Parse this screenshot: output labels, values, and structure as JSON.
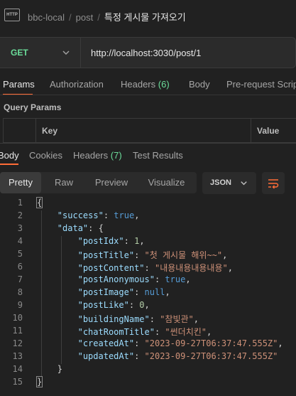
{
  "header": {
    "app_icon": "http-file-icon",
    "app_icon_text": "HTTP",
    "breadcrumb": [
      "bbc-local",
      "post"
    ],
    "separator": "/",
    "request_name": "특정 게시물 가져오기"
  },
  "request": {
    "method": "GET",
    "method_color": "#6bdd9a",
    "url": "http://localhost:3030/post/1"
  },
  "request_tabs": [
    {
      "label": "Params",
      "count": null,
      "active": true
    },
    {
      "label": "Authorization",
      "count": null,
      "active": false
    },
    {
      "label": "Headers",
      "count": "(6)",
      "active": false
    },
    {
      "label": "Body",
      "count": null,
      "active": false
    },
    {
      "label": "Pre-request Scrip",
      "count": null,
      "active": false
    }
  ],
  "query_params": {
    "title": "Query Params",
    "columns": [
      "Key",
      "Value"
    ]
  },
  "response_tabs": [
    {
      "label": "Body",
      "count": null,
      "active": true
    },
    {
      "label": "Cookies",
      "count": null,
      "active": false
    },
    {
      "label": "Headers",
      "count": "(7)",
      "active": false
    },
    {
      "label": "Test Results",
      "count": null,
      "active": false
    }
  ],
  "view_modes": [
    "Pretty",
    "Raw",
    "Preview",
    "Visualize"
  ],
  "active_view_mode": "Pretty",
  "format": "JSON",
  "wrap_icon": "wrap-lines-icon",
  "accent_color": "#ff6c37",
  "response_lines": [
    {
      "n": "1",
      "tokens": [
        [
          "p",
          "{"
        ]
      ]
    },
    {
      "n": "2",
      "tokens": [
        [
          "k",
          "\"success\""
        ],
        [
          "p",
          ": "
        ],
        [
          "b",
          "true"
        ],
        [
          "p",
          ","
        ]
      ]
    },
    {
      "n": "3",
      "tokens": [
        [
          "k",
          "\"data\""
        ],
        [
          "p",
          ": {"
        ]
      ]
    },
    {
      "n": "4",
      "tokens": [
        [
          "k",
          "\"postIdx\""
        ],
        [
          "p",
          ": "
        ],
        [
          "n",
          "1"
        ],
        [
          "p",
          ","
        ]
      ]
    },
    {
      "n": "5",
      "tokens": [
        [
          "k",
          "\"postTitle\""
        ],
        [
          "p",
          ": "
        ],
        [
          "s",
          "\"첫 게시물 해위~~\""
        ],
        [
          "p",
          ","
        ]
      ]
    },
    {
      "n": "6",
      "tokens": [
        [
          "k",
          "\"postContent\""
        ],
        [
          "p",
          ": "
        ],
        [
          "s",
          "\"내용내용내용내용\""
        ],
        [
          "p",
          ","
        ]
      ]
    },
    {
      "n": "7",
      "tokens": [
        [
          "k",
          "\"postAnonymous\""
        ],
        [
          "p",
          ": "
        ],
        [
          "b",
          "true"
        ],
        [
          "p",
          ","
        ]
      ]
    },
    {
      "n": "8",
      "tokens": [
        [
          "k",
          "\"postImage\""
        ],
        [
          "p",
          ": "
        ],
        [
          "b",
          "null"
        ],
        [
          "p",
          ","
        ]
      ]
    },
    {
      "n": "9",
      "tokens": [
        [
          "k",
          "\"postLike\""
        ],
        [
          "p",
          ": "
        ],
        [
          "n",
          "0"
        ],
        [
          "p",
          ","
        ]
      ]
    },
    {
      "n": "10",
      "tokens": [
        [
          "k",
          "\"buildingName\""
        ],
        [
          "p",
          ": "
        ],
        [
          "s",
          "\"참빛관\""
        ],
        [
          "p",
          ","
        ]
      ]
    },
    {
      "n": "11",
      "tokens": [
        [
          "k",
          "\"chatRoomTitle\""
        ],
        [
          "p",
          ": "
        ],
        [
          "s",
          "\"썬더치킨\""
        ],
        [
          "p",
          ","
        ]
      ]
    },
    {
      "n": "12",
      "tokens": [
        [
          "k",
          "\"createdAt\""
        ],
        [
          "p",
          ": "
        ],
        [
          "s",
          "\"2023-09-27T06:37:47.555Z\""
        ],
        [
          "p",
          ","
        ]
      ]
    },
    {
      "n": "13",
      "tokens": [
        [
          "k",
          "\"updatedAt\""
        ],
        [
          "p",
          ": "
        ],
        [
          "s",
          "\"2023-09-27T06:37:47.555Z\""
        ]
      ]
    },
    {
      "n": "14",
      "tokens": [
        [
          "p",
          "}"
        ]
      ]
    },
    {
      "n": "15",
      "tokens": [
        [
          "p",
          "}"
        ]
      ]
    }
  ]
}
